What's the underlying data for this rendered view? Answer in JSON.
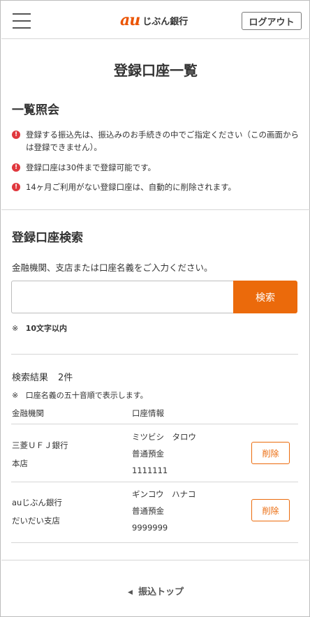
{
  "header": {
    "logo_mark": "au",
    "logo_text": "じぶん銀行",
    "logout_label": "ログアウト"
  },
  "page_title": "登録口座一覧",
  "overview": {
    "heading": "一覧照会",
    "notices": [
      "登録する振込先は、振込みのお手続きの中でご指定ください（この画面からは登録できません）。",
      "登録口座は30件まで登録可能です。",
      "14ヶ月ご利用がない登録口座は、自動的に削除されます。"
    ]
  },
  "search": {
    "heading": "登録口座検索",
    "guide": "金融機関、支店または口座名義をご入力ください。",
    "input_value": "",
    "button_label": "検索",
    "note_mark": "※",
    "note_text": "10文字以内"
  },
  "results": {
    "count_label": "検索結果",
    "count_value": "2件",
    "sort_note_mark": "※",
    "sort_note": "口座名義の五十音順で表示します。",
    "columns": [
      "金融機関",
      "口座情報"
    ],
    "rows": [
      {
        "bank": "三菱ＵＦＪ銀行",
        "branch": "本店",
        "name": "ミツビシ　タロウ",
        "type": "普通預金",
        "number": "1111111",
        "delete_label": "削除"
      },
      {
        "bank": "auじぶん銀行",
        "branch": "だいだい支店",
        "name": "ギンコウ　ハナコ",
        "type": "普通預金",
        "number": "9999999",
        "delete_label": "削除"
      }
    ]
  },
  "footer": {
    "back_label": "振込トップ"
  },
  "colors": {
    "accent": "#eb6a0b",
    "alert": "#e0383e",
    "brand": "#eb5505"
  }
}
